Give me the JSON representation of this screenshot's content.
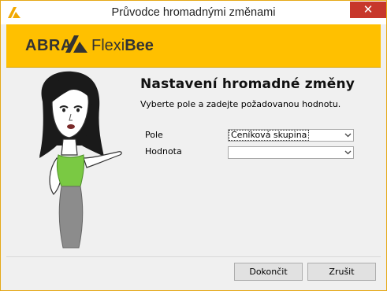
{
  "window": {
    "title": "Průvodce hromadnými změnami",
    "close_glyph": "✕",
    "accent_color": "#ffc000"
  },
  "banner": {
    "logo_abra": "ABRA",
    "logo_flexi": "Flexi",
    "logo_bee": "Bee"
  },
  "main": {
    "heading": "Nastavení hromadné změny",
    "subtitle": "Vyberte pole a zadejte požadovanou hodnotu.",
    "fields": [
      {
        "label": "Pole",
        "value": "Ceníková skupina"
      },
      {
        "label": "Hodnota",
        "value": ""
      }
    ]
  },
  "footer": {
    "finish_label": "Dokončit",
    "cancel_label": "Zrušit"
  }
}
